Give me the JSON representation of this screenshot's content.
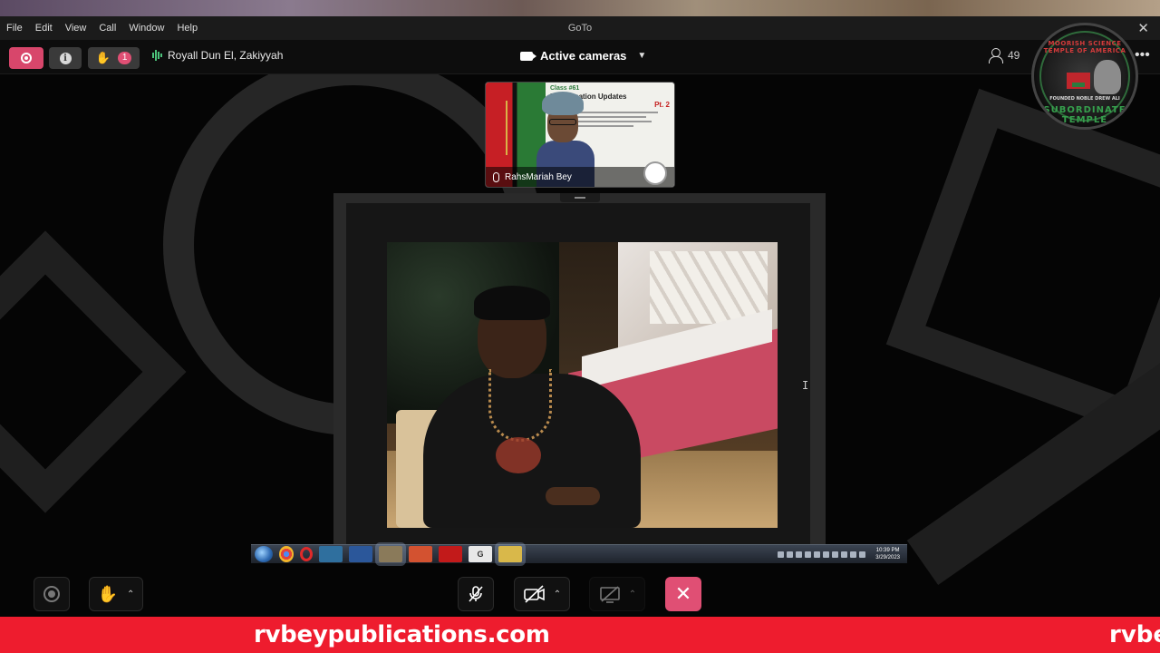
{
  "menubar": {
    "items": [
      "File",
      "Edit",
      "View",
      "Call",
      "Window",
      "Help"
    ],
    "app_title": "GoTo",
    "close_glyph": "✕"
  },
  "toolbar": {
    "hand_raise_count": "1",
    "current_speaker": "Royall Dun El, Zakiyyah",
    "cameras_label": "Active cameras",
    "participant_count": "49",
    "more_glyph": "•••"
  },
  "temple_logo": {
    "top_text": "MOORISH SCIENCE TEMPLE OF AMERICA",
    "middle_text": "FOUNDED NOBLE DREW ALI",
    "bottom_text": "SUBORDINATE TEMPLE"
  },
  "thumbnail": {
    "participant_name": "RahsMariah Bey",
    "slide_class": "Class #61",
    "slide_title": "Proclamation Updates",
    "slide_part": "Pt. 2"
  },
  "taskbar": {
    "clock_time": "10:39 PM",
    "clock_date": "3/29/2023",
    "g_label": "G"
  },
  "controls": {
    "leave_glyph": "✕",
    "raise_hand_glyph": "✋",
    "chevron_glyph": "⌃"
  },
  "banner": {
    "text": "rvbeypublications.com",
    "text_repeat": "rvbe"
  },
  "colors": {
    "accent": "#e04f74",
    "banner": "#ee1c2e",
    "audio_level": "#4bc27a"
  },
  "icons": [
    "record-icon",
    "info-icon",
    "raise-hand-icon",
    "audio-level-icon",
    "camera-icon",
    "chevron-down-icon",
    "person-icon",
    "more-icon",
    "mic-icon",
    "mic-off-icon",
    "video-off-icon",
    "screen-share-off-icon",
    "close-icon",
    "windows-start-icon"
  ]
}
